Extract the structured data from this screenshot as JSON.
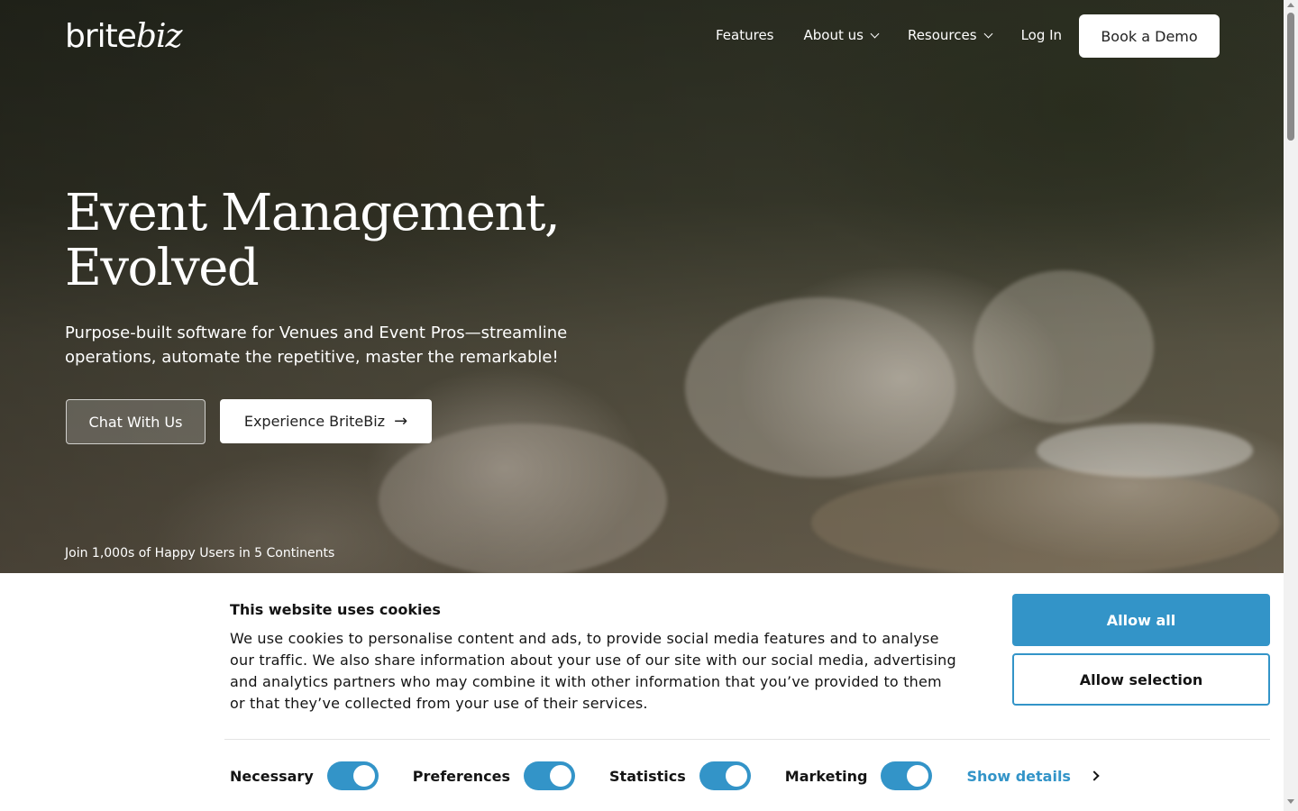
{
  "header": {
    "logo_left": "brite",
    "logo_right": "biz",
    "nav": [
      {
        "label": "Features",
        "dropdown": false
      },
      {
        "label": "About us",
        "dropdown": true
      },
      {
        "label": "Resources",
        "dropdown": true
      },
      {
        "label": "Log In",
        "dropdown": false
      }
    ],
    "cta_label": "Book a Demo"
  },
  "hero": {
    "title_line1": "Event Management,",
    "title_line2": "Evolved",
    "subtitle": "Purpose-built software for Venues and Event Pros—streamline operations, automate the repetitive, master the remarkable!",
    "chat_button": "Chat With Us",
    "experience_button": "Experience BriteBiz",
    "experience_icon": "arrow-right-icon",
    "social_proof": "Join 1,000s of Happy Users in 5 Continents"
  },
  "cookie_banner": {
    "title": "This website uses cookies",
    "body": "We use cookies to personalise content and ads, to provide social media features and to analyse our traffic. We also share information about your use of our site with our social media, advertising and analytics partners who may combine it with other information that you’ve provided to them or that they’ve collected from your use of their services.",
    "allow_all": "Allow all",
    "allow_selection": "Allow selection",
    "consents": [
      {
        "label": "Necessary",
        "checked": true
      },
      {
        "label": "Preferences",
        "checked": true
      },
      {
        "label": "Statistics",
        "checked": true
      },
      {
        "label": "Marketing",
        "checked": true
      }
    ],
    "show_details": "Show details"
  },
  "colors": {
    "accent": "#3394c8",
    "text": "#141414"
  }
}
